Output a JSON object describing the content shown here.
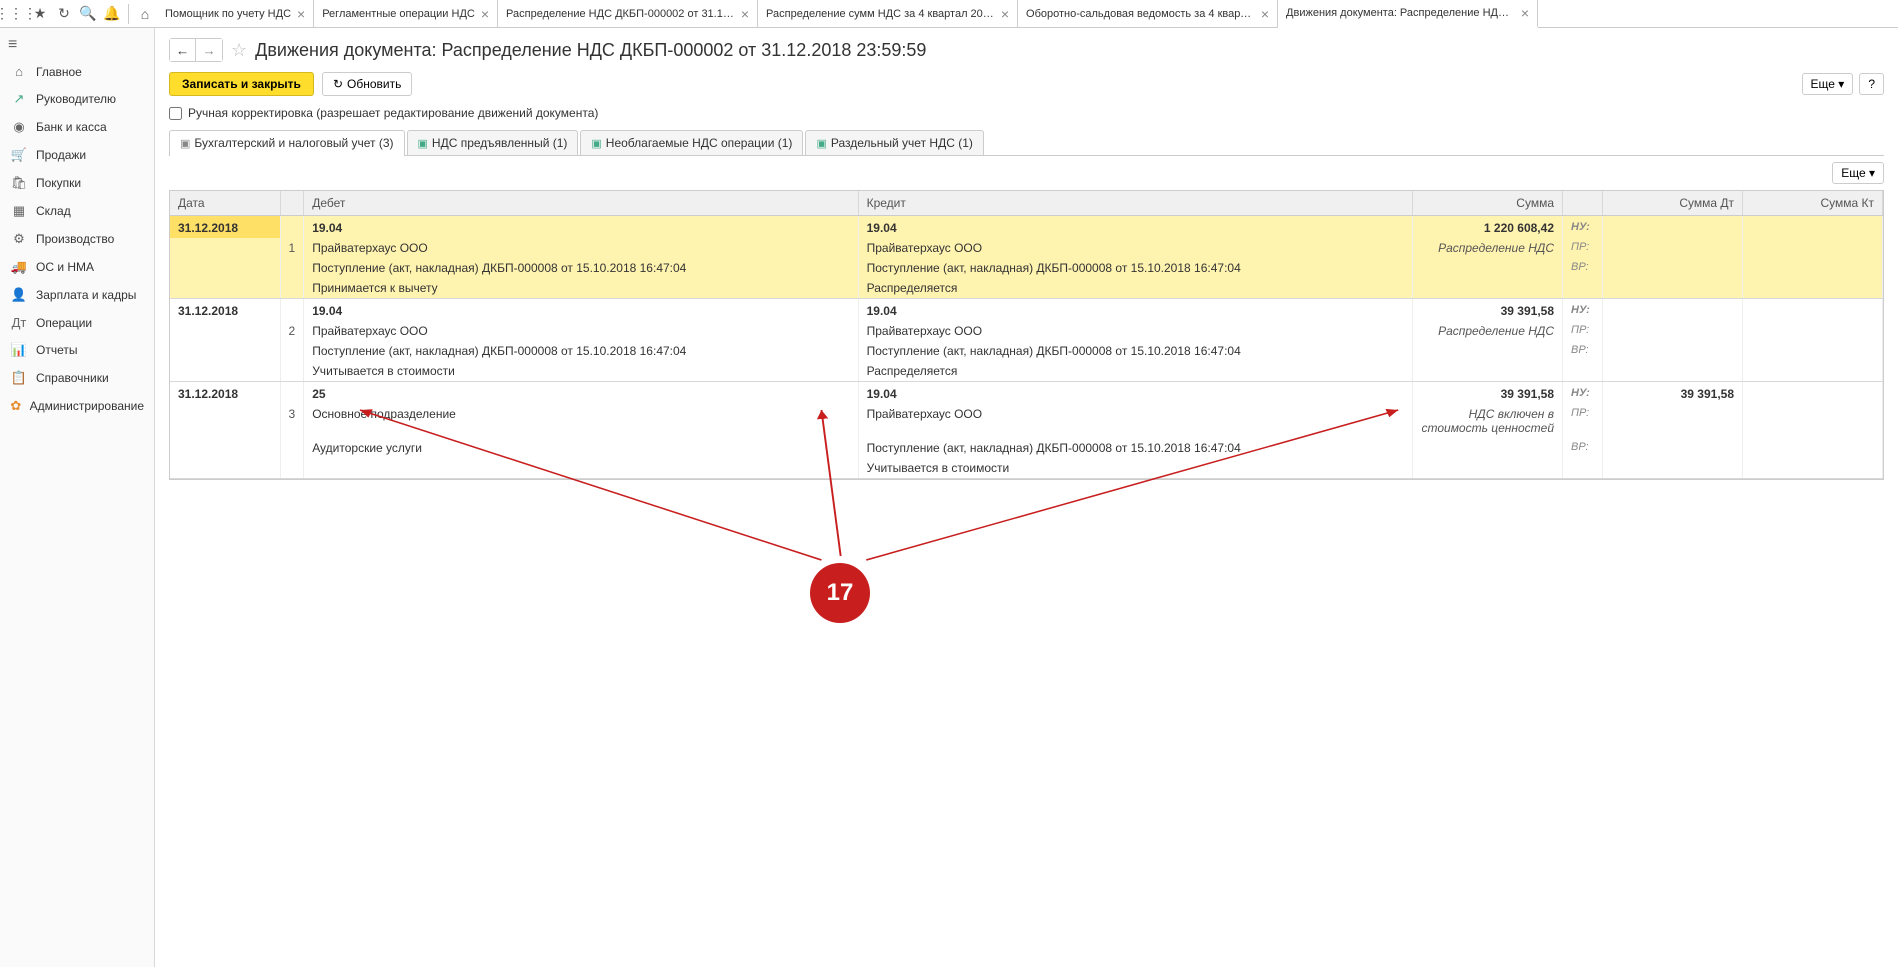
{
  "toolbar_icons": [
    "apps",
    "star",
    "refresh",
    "search",
    "bell"
  ],
  "home_icon": "home",
  "tabs": [
    {
      "label": "Помощник по учету НДС",
      "close": true
    },
    {
      "label": "Регламентные операции НДС",
      "close": true
    },
    {
      "label": "Распределение НДС ДКБП-000002 от 31.12....",
      "close": true
    },
    {
      "label": "Распределение сумм НДС за 4 квартал 201...",
      "close": true
    },
    {
      "label": "Оборотно-сальдовая ведомость за 4 кварта...",
      "close": true
    },
    {
      "label": "Движения документа: Распределение НДС ...",
      "close": true,
      "active": true
    }
  ],
  "sidebar": [
    {
      "icon": "≡",
      "label": "",
      "type": "hamburger"
    },
    {
      "icon": "⌂",
      "label": "Главное"
    },
    {
      "icon": "↗",
      "label": "Руководителю",
      "iconClass": "g"
    },
    {
      "icon": "◉",
      "label": "Банк и касса"
    },
    {
      "icon": "🛒",
      "label": "Продажи"
    },
    {
      "icon": "🛍",
      "label": "Покупки"
    },
    {
      "icon": "▦",
      "label": "Склад"
    },
    {
      "icon": "⚙",
      "label": "Производство"
    },
    {
      "icon": "🚚",
      "label": "ОС и НМА"
    },
    {
      "icon": "👤",
      "label": "Зарплата и кадры"
    },
    {
      "icon": "Дт",
      "label": "Операции"
    },
    {
      "icon": "📊",
      "label": "Отчеты"
    },
    {
      "icon": "📋",
      "label": "Справочники"
    },
    {
      "icon": "✿",
      "label": "Администрирование",
      "iconClass": "o"
    }
  ],
  "page_title": "Движения документа: Распределение НДС ДКБП-000002 от 31.12.2018 23:59:59",
  "actions": {
    "save_close": "Записать и закрыть",
    "refresh": "Обновить",
    "more": "Еще",
    "help": "?"
  },
  "manual_edit_label": "Ручная корректировка (разрешает редактирование движений документа)",
  "inner_tabs": [
    {
      "label": "Бухгалтерский и налоговый учет (3)",
      "active": true,
      "iconClass": ""
    },
    {
      "label": "НДС предъявленный (1)",
      "iconClass": "g"
    },
    {
      "label": "Необлагаемые НДС операции (1)",
      "iconClass": "g"
    },
    {
      "label": "Раздельный учет НДС (1)",
      "iconClass": "g"
    }
  ],
  "table": {
    "more": "Еще",
    "headers": [
      "Дата",
      "Дебет",
      "Кредит",
      "Сумма",
      "",
      "Сумма Дт",
      "Сумма Кт"
    ],
    "entries": [
      {
        "selected": true,
        "date": "31.12.2018",
        "num": "1",
        "debit_acc": "19.04",
        "credit_acc": "19.04",
        "sum": "1 220 608,42",
        "cur_labels": [
          "НУ:",
          "ПР:",
          "ВР:"
        ],
        "debit_lines": [
          "Прайватерхаус ООО",
          "Поступление (акт, накладная) ДКБП-000008 от 15.10.2018 16:47:04",
          "Принимается к вычету"
        ],
        "credit_lines": [
          "Прайватерхаус ООО",
          "Поступление (акт, накладная) ДКБП-000008 от 15.10.2018 16:47:04",
          "Распределяется"
        ],
        "desc": "Распределение НДС",
        "sum_dt": "",
        "sum_kt": ""
      },
      {
        "date": "31.12.2018",
        "num": "2",
        "debit_acc": "19.04",
        "credit_acc": "19.04",
        "sum": "39 391,58",
        "cur_labels": [
          "НУ:",
          "ПР:",
          "ВР:"
        ],
        "debit_lines": [
          "Прайватерхаус ООО",
          "Поступление (акт, накладная) ДКБП-000008 от 15.10.2018 16:47:04",
          "Учитывается в стоимости"
        ],
        "credit_lines": [
          "Прайватерхаус ООО",
          "Поступление (акт, накладная) ДКБП-000008 от 15.10.2018 16:47:04",
          "Распределяется"
        ],
        "desc": "Распределение НДС",
        "sum_dt": "",
        "sum_kt": ""
      },
      {
        "date": "31.12.2018",
        "num": "3",
        "debit_acc": "25",
        "credit_acc": "19.04",
        "sum": "39 391,58",
        "cur_labels": [
          "НУ:",
          "ПР:",
          "ВР:"
        ],
        "debit_lines": [
          "Основное подразделение",
          "Аудиторские услуги",
          ""
        ],
        "credit_lines": [
          "Прайватерхаус ООО",
          "Поступление (акт, накладная) ДКБП-000008 от 15.10.2018 16:47:04",
          "Учитывается в стоимости"
        ],
        "desc": "НДС включен в стоимость ценностей",
        "sum_dt": "39 391,58",
        "sum_kt": ""
      }
    ]
  },
  "annotation_number": "17"
}
